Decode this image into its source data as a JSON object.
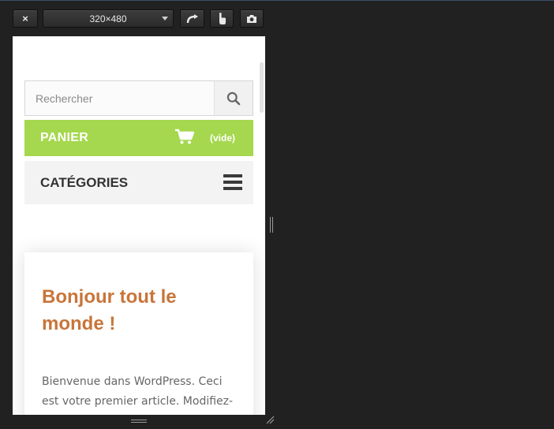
{
  "toolbar": {
    "close_label": "×",
    "size_label": "320×480",
    "rotate_icon": "rotate-icon",
    "touch_icon": "touch-icon",
    "screenshot_icon": "camera-icon"
  },
  "page": {
    "search": {
      "placeholder": "Rechercher",
      "value": ""
    },
    "cart": {
      "title": "PANIER",
      "status": "(vide)",
      "color": "#a5d84e"
    },
    "categories": {
      "title": "CATÉGORIES"
    },
    "article": {
      "title": "Bonjour tout le monde !",
      "excerpt": "Bienvenue dans WordPress. Ceci est votre premier article. Modifiez-le ou",
      "title_color": "#c8753a"
    }
  }
}
